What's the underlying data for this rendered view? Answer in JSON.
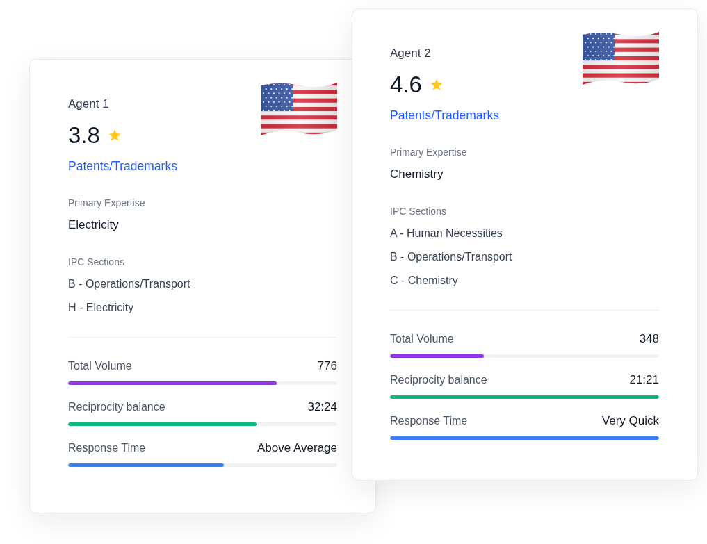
{
  "cards": [
    {
      "title": "Agent 1",
      "rating": "3.8",
      "category": "Patents/Trademarks",
      "expertise": {
        "label": "Primary Expertise",
        "value": "Electricity"
      },
      "ipc_sections": {
        "label": "IPC Sections",
        "items": [
          "B - Operations/Transport",
          "H - Electricity"
        ]
      },
      "metrics": [
        {
          "label": "Total Volume",
          "value": "776",
          "level": 0.776,
          "color": "#9333ea"
        },
        {
          "label": "Reciprocity balance",
          "value": "32:24",
          "level": 0.7,
          "color": "#10b981"
        },
        {
          "label": "Response Time",
          "value": "Above Average",
          "level": 0.58,
          "color": "#3b82f6"
        }
      ]
    },
    {
      "title": "Agent 2",
      "rating": "4.6",
      "category": "Patents/Trademarks",
      "expertise": {
        "label": "Primary Expertise",
        "value": "Chemistry"
      },
      "ipc_sections": {
        "label": "IPC Sections",
        "items": [
          "A - Human Necessities",
          "B - Operations/Transport",
          "C - Chemistry"
        ]
      },
      "metrics": [
        {
          "label": "Total Volume",
          "value": "348",
          "level": 0.348,
          "color": "#9333ea"
        },
        {
          "label": "Reciprocity balance",
          "value": "21:21",
          "level": 1,
          "color": "#10b981"
        },
        {
          "label": "Response Time",
          "value": "Very Quick",
          "level": 1,
          "color": "#3b82f6"
        }
      ]
    }
  ]
}
